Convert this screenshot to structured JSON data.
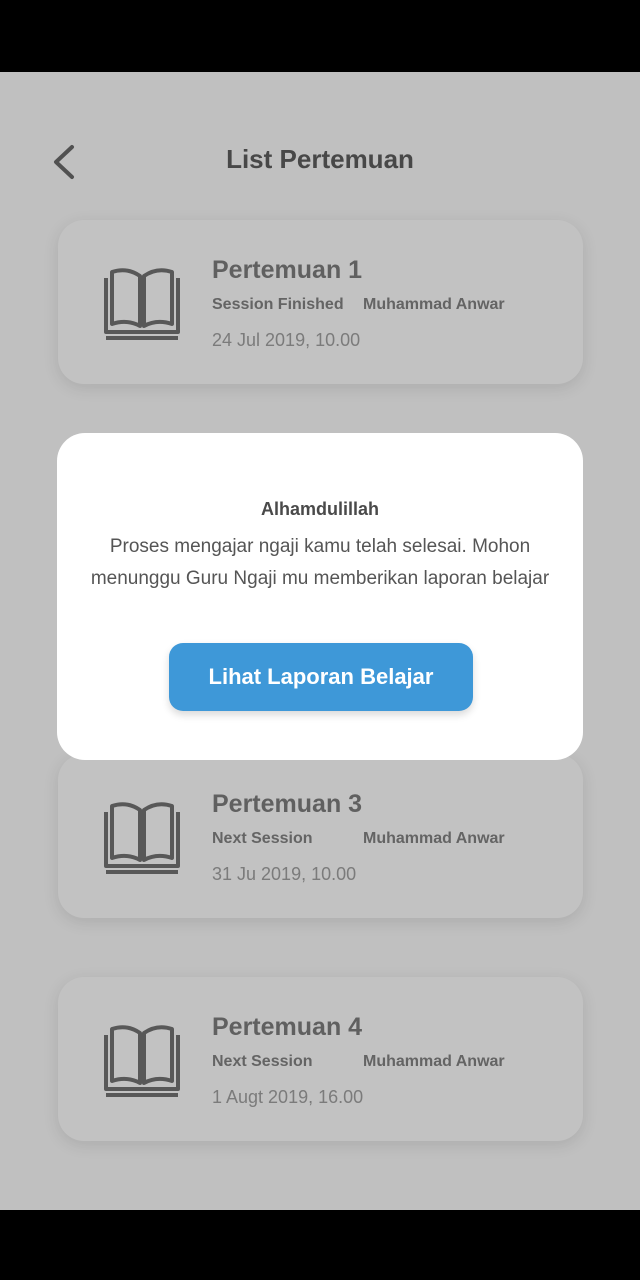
{
  "header": {
    "title": "List Pertemuan",
    "back_icon": "chevron-left-icon"
  },
  "sessions": [
    {
      "title": "Pertemuan 1",
      "status": "Session Finished",
      "teacher": "Muhammad Anwar",
      "date": "24 Jul 2019, 10.00",
      "icon": "open-book-icon"
    },
    {
      "title": "Pertemuan 3",
      "status": "Next Session",
      "teacher": "Muhammad Anwar",
      "date": "31 Ju 2019, 10.00",
      "icon": "open-book-icon"
    },
    {
      "title": "Pertemuan 4",
      "status": "Next Session",
      "teacher": "Muhammad Anwar",
      "date": "1 Augt 2019, 16.00",
      "icon": "open-book-icon"
    }
  ],
  "dialog": {
    "heading": "Alhamdulillah",
    "message": "Proses mengajar ngaji kamu telah selesai. Mohon menunggu Guru Ngaji mu memberikan laporan belajar",
    "button_label": "Lihat Laporan Belajar"
  },
  "colors": {
    "accent": "#3e98d8",
    "background": "#f0f0f0",
    "card": "#f3f3f3"
  }
}
